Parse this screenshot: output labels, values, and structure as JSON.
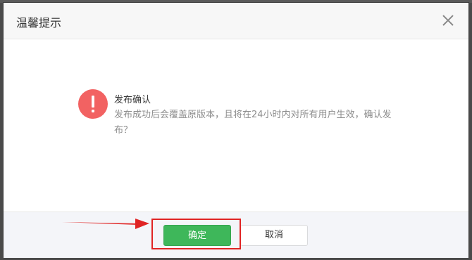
{
  "dialog": {
    "title": "温馨提示",
    "close_icon": "close-icon"
  },
  "message": {
    "icon": "exclamation-icon",
    "icon_color": "#f26262",
    "title": "发布确认",
    "description": "发布成功后会覆盖原版本，且将在24小时内对所有用户生效，确认发布？"
  },
  "footer": {
    "confirm_label": "确定",
    "cancel_label": "取消",
    "confirm_color": "#3eb75a"
  },
  "annotation": {
    "highlight_color": "#e02424",
    "arrow_color": "#e02424"
  }
}
